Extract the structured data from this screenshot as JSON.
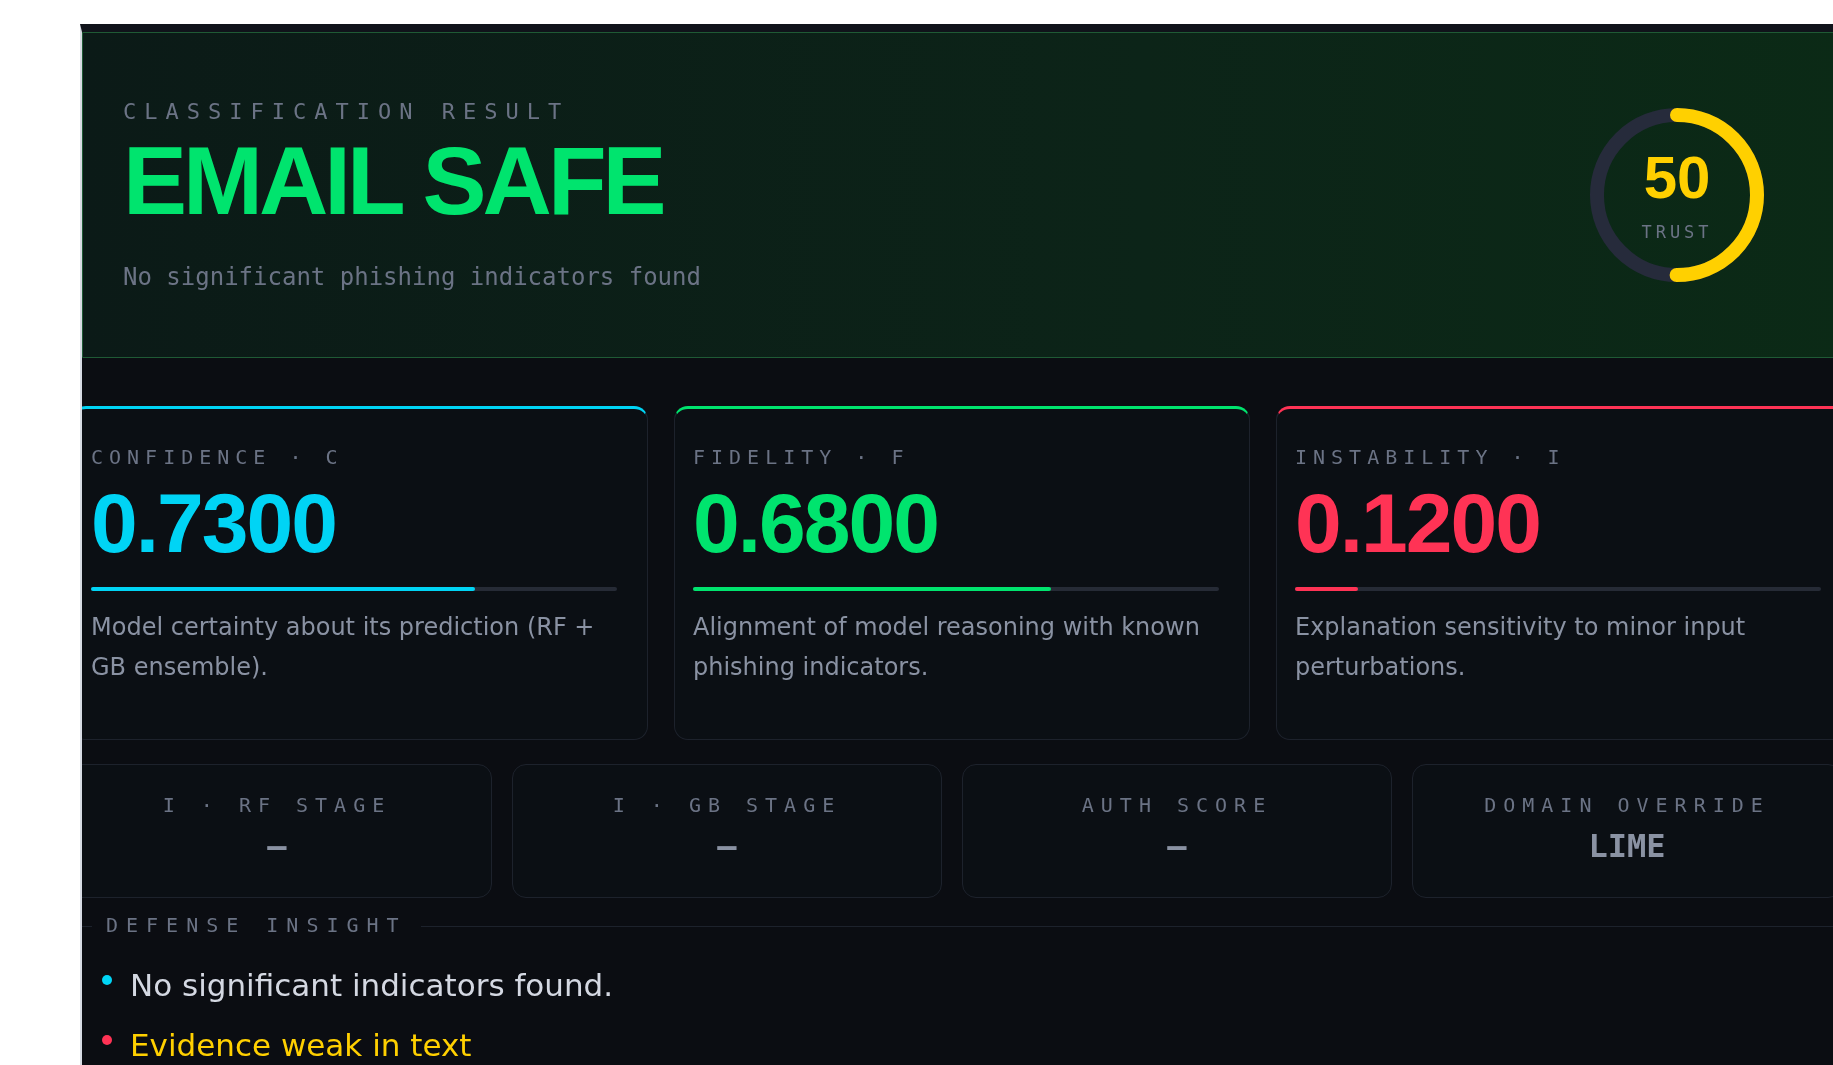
{
  "result": {
    "eyebrow": "CLASSIFICATION RESULT",
    "verdict": "EMAIL SAFE",
    "summary": "No significant phishing indicators found",
    "trust": {
      "value": "50",
      "label": "TRUST",
      "level": 0.5
    }
  },
  "metrics": [
    {
      "label": "CONFIDENCE · C",
      "value": "0.7300",
      "level": 0.73,
      "color": "#00d4f5",
      "description": "Model certainty about its prediction (RF + GB ensemble)."
    },
    {
      "label": "FIDELITY · F",
      "value": "0.6800",
      "level": 0.68,
      "color": "#00e46e",
      "description": "Alignment of model reasoning with known phishing indicators."
    },
    {
      "label": "INSTABILITY · I",
      "value": "0.1200",
      "level": 0.12,
      "color": "#ff3355",
      "description": "Explanation sensitivity to minor input perturbations."
    }
  ],
  "stages": [
    {
      "label": "I · RF STAGE",
      "value": "–"
    },
    {
      "label": "I · GB STAGE",
      "value": "–"
    },
    {
      "label": "AUTH SCORE",
      "value": "–"
    },
    {
      "label": "DOMAIN OVERRIDE",
      "value": "LIME"
    }
  ],
  "insight": {
    "title": "DEFENSE INSIGHT",
    "items": [
      {
        "text": "No significant indicators found.",
        "color": "#00d4f5",
        "kind": "info"
      },
      {
        "text": "Evidence weak in text",
        "color": "#ff3355",
        "kind": "warning"
      }
    ]
  }
}
